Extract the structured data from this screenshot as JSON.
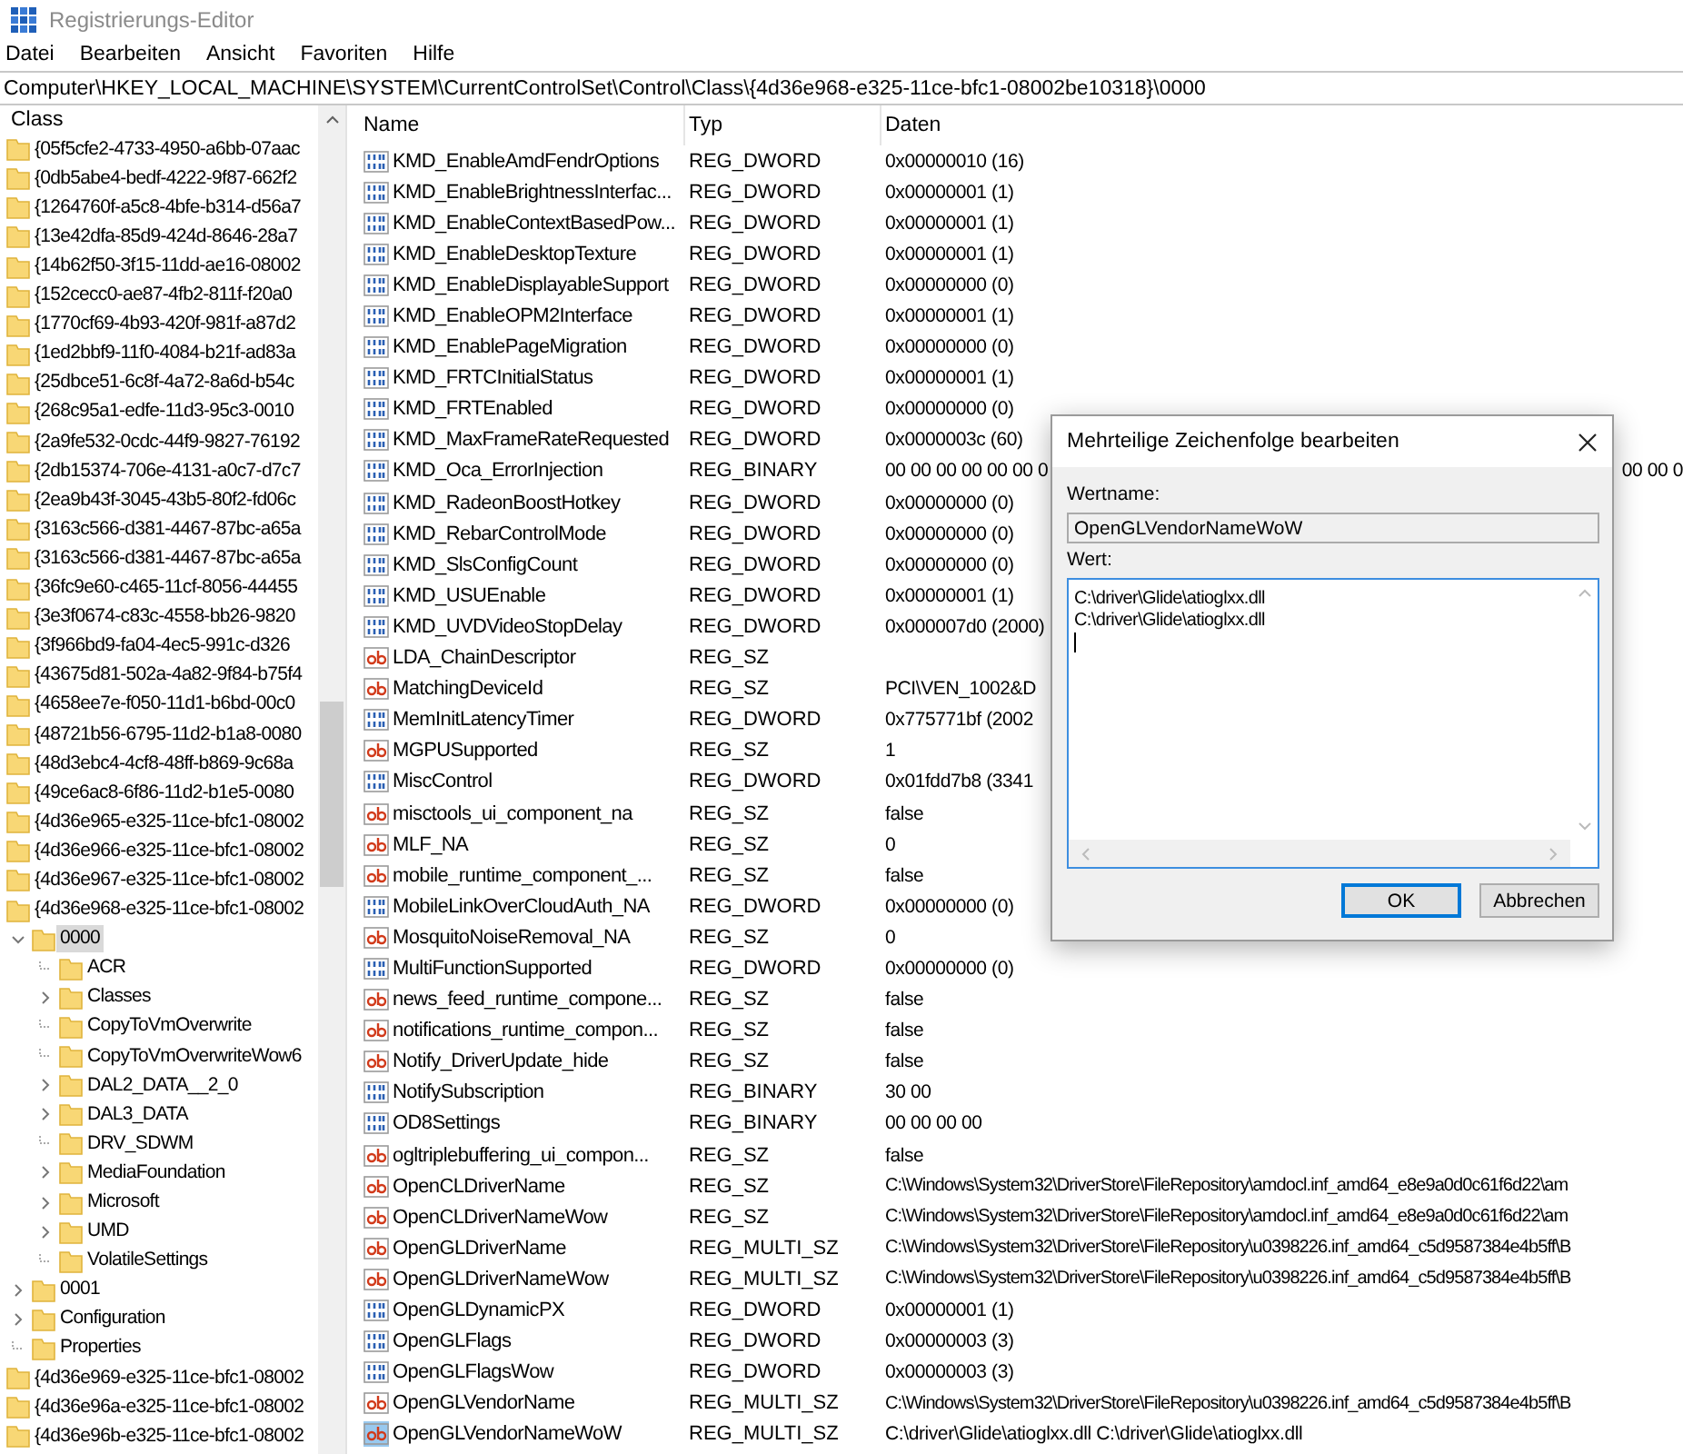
{
  "window": {
    "title": "Registrierungs-Editor"
  },
  "menu": [
    "Datei",
    "Bearbeiten",
    "Ansicht",
    "Favoriten",
    "Hilfe"
  ],
  "address": "Computer\\HKEY_LOCAL_MACHINE\\SYSTEM\\CurrentControlSet\\Control\\Class\\{4d36e968-e325-11ce-bfc1-08002be10318}\\0000",
  "tree": {
    "parent_label": "Class",
    "items": [
      {
        "label": "{05f5cfe2-4733-4950-a6bb-07aac",
        "selected": false
      },
      {
        "label": "{0db5abe4-bedf-4222-9f87-662f2",
        "selected": false
      },
      {
        "label": "{1264760f-a5c8-4bfe-b314-d56a7",
        "selected": false
      },
      {
        "label": "{13e42dfa-85d9-424d-8646-28a7",
        "selected": false
      },
      {
        "label": "{14b62f50-3f15-11dd-ae16-08002",
        "selected": false
      },
      {
        "label": "{152cecc0-ae87-4fb2-811f-f20a0",
        "selected": false
      },
      {
        "label": "{1770cf69-4b93-420f-981f-a87d2",
        "selected": false
      },
      {
        "label": "{1ed2bbf9-11f0-4084-b21f-ad83a",
        "selected": false
      },
      {
        "label": "{25dbce51-6c8f-4a72-8a6d-b54c",
        "selected": false
      },
      {
        "label": "{268c95a1-edfe-11d3-95c3-0010",
        "selected": false
      },
      {
        "label": "{2a9fe532-0cdc-44f9-9827-76192",
        "selected": false
      },
      {
        "label": "{2db15374-706e-4131-a0c7-d7c7",
        "selected": false
      },
      {
        "label": "{2ea9b43f-3045-43b5-80f2-fd06c",
        "selected": false
      },
      {
        "label": "{3163c566-d381-4467-87bc-a65a",
        "selected": false
      },
      {
        "label": "{3163c566-d381-4467-87bc-a65a",
        "selected": false
      },
      {
        "label": "{36fc9e60-c465-11cf-8056-44455",
        "selected": false
      },
      {
        "label": "{3e3f0674-c83c-4558-bb26-9820",
        "selected": false
      },
      {
        "label": "{3f966bd9-fa04-4ec5-991c-d326",
        "selected": false
      },
      {
        "label": "{43675d81-502a-4a82-9f84-b75f4",
        "selected": false
      },
      {
        "label": "{4658ee7e-f050-11d1-b6bd-00c0",
        "selected": false
      },
      {
        "label": "{48721b56-6795-11d2-b1a8-0080",
        "selected": false
      },
      {
        "label": "{48d3ebc4-4cf8-48ff-b869-9c68a",
        "selected": false
      },
      {
        "label": "{49ce6ac8-6f86-11d2-b1e5-0080",
        "selected": false
      },
      {
        "label": "{4d36e965-e325-11ce-bfc1-08002",
        "selected": false
      },
      {
        "label": "{4d36e966-e325-11ce-bfc1-08002",
        "selected": false
      },
      {
        "label": "{4d36e967-e325-11ce-bfc1-08002",
        "selected": false
      },
      {
        "label": "{4d36e968-e325-11ce-bfc1-08002",
        "selected": false,
        "children": [
          {
            "label": "0000",
            "selected": true,
            "expandable": true,
            "expanded": true,
            "children": [
              {
                "label": "ACR",
                "selected": false,
                "expandable": false
              },
              {
                "label": "Classes",
                "selected": false,
                "expandable": true,
                "expanded": false
              },
              {
                "label": "CopyToVmOverwrite",
                "selected": false,
                "expandable": false
              },
              {
                "label": "CopyToVmOverwriteWow6",
                "selected": false,
                "expandable": false
              },
              {
                "label": "DAL2_DATA__2_0",
                "selected": false,
                "expandable": true,
                "expanded": false
              },
              {
                "label": "DAL3_DATA",
                "selected": false,
                "expandable": true,
                "expanded": false
              },
              {
                "label": "DRV_SDWM",
                "selected": false,
                "expandable": false
              },
              {
                "label": "MediaFoundation",
                "selected": false,
                "expandable": true,
                "expanded": false
              },
              {
                "label": "Microsoft",
                "selected": false,
                "expandable": true,
                "expanded": false
              },
              {
                "label": "UMD",
                "selected": false,
                "expandable": true,
                "expanded": false
              },
              {
                "label": "VolatileSettings",
                "selected": false,
                "expandable": false
              }
            ]
          },
          {
            "label": "0001",
            "selected": false,
            "expandable": true,
            "expanded": false
          },
          {
            "label": "Configuration",
            "selected": false,
            "expandable": true,
            "expanded": false
          },
          {
            "label": "Properties",
            "selected": false,
            "expandable": false
          }
        ]
      },
      {
        "label": "{4d36e969-e325-11ce-bfc1-08002",
        "selected": false
      },
      {
        "label": "{4d36e96a-e325-11ce-bfc1-08002",
        "selected": false
      },
      {
        "label": "{4d36e96b-e325-11ce-bfc1-08002",
        "selected": false
      }
    ]
  },
  "table": {
    "columns": [
      "Name",
      "Typ",
      "Daten"
    ],
    "rows": [
      {
        "kind": "binary",
        "name": "KMD_EnableAmdFendrOptions",
        "type": "REG_DWORD",
        "data": "0x00000010 (16)",
        "selected": false
      },
      {
        "kind": "binary",
        "name": "KMD_EnableBrightnessInterfac...",
        "type": "REG_DWORD",
        "data": "0x00000001 (1)",
        "selected": false
      },
      {
        "kind": "binary",
        "name": "KMD_EnableContextBasedPow...",
        "type": "REG_DWORD",
        "data": "0x00000001 (1)",
        "selected": false
      },
      {
        "kind": "binary",
        "name": "KMD_EnableDesktopTexture",
        "type": "REG_DWORD",
        "data": "0x00000001 (1)",
        "selected": false
      },
      {
        "kind": "binary",
        "name": "KMD_EnableDisplayableSupport",
        "type": "REG_DWORD",
        "data": "0x00000000 (0)",
        "selected": false
      },
      {
        "kind": "binary",
        "name": "KMD_EnableOPM2Interface",
        "type": "REG_DWORD",
        "data": "0x00000001 (1)",
        "selected": false
      },
      {
        "kind": "binary",
        "name": "KMD_EnablePageMigration",
        "type": "REG_DWORD",
        "data": "0x00000000 (0)",
        "selected": false
      },
      {
        "kind": "binary",
        "name": "KMD_FRTCInitialStatus",
        "type": "REG_DWORD",
        "data": "0x00000001 (1)",
        "selected": false
      },
      {
        "kind": "binary",
        "name": "KMD_FRTEnabled",
        "type": "REG_DWORD",
        "data": "0x00000000 (0)",
        "selected": false
      },
      {
        "kind": "binary",
        "name": "KMD_MaxFrameRateRequested",
        "type": "REG_DWORD",
        "data": "0x0000003c (60)",
        "selected": false
      },
      {
        "kind": "binary",
        "name": "KMD_Oca_ErrorInjection",
        "type": "REG_BINARY",
        "data": "00 00 00 00 00 00 0",
        "data_tail": "00 00 0",
        "selected": false
      },
      {
        "kind": "binary",
        "name": "KMD_RadeonBoostHotkey",
        "type": "REG_DWORD",
        "data": "0x00000000 (0)",
        "selected": false
      },
      {
        "kind": "binary",
        "name": "KMD_RebarControlMode",
        "type": "REG_DWORD",
        "data": "0x00000000 (0)",
        "selected": false
      },
      {
        "kind": "binary",
        "name": "KMD_SlsConfigCount",
        "type": "REG_DWORD",
        "data": "0x00000000 (0)",
        "selected": false
      },
      {
        "kind": "binary",
        "name": "KMD_USUEnable",
        "type": "REG_DWORD",
        "data": "0x00000001 (1)",
        "selected": false
      },
      {
        "kind": "binary",
        "name": "KMD_UVDVideoStopDelay",
        "type": "REG_DWORD",
        "data": "0x000007d0 (2000)",
        "selected": false
      },
      {
        "kind": "string",
        "name": "LDA_ChainDescriptor",
        "type": "REG_SZ",
        "selected": false
      },
      {
        "kind": "string",
        "name": "MatchingDeviceId",
        "type": "REG_SZ",
        "data": "PCI\\VEN_1002&D",
        "selected": false
      },
      {
        "kind": "binary",
        "name": "MemInitLatencyTimer",
        "type": "REG_DWORD",
        "data": "0x775771bf (2002",
        "selected": false
      },
      {
        "kind": "string",
        "name": "MGPUSupported",
        "type": "REG_SZ",
        "data": "1",
        "selected": false
      },
      {
        "kind": "binary",
        "name": "MiscControl",
        "type": "REG_DWORD",
        "data": "0x01fdd7b8 (3341",
        "selected": false
      },
      {
        "kind": "string",
        "name": "misctools_ui_component_na",
        "type": "REG_SZ",
        "data": "false",
        "selected": false
      },
      {
        "kind": "string",
        "name": "MLF_NA",
        "type": "REG_SZ",
        "data": "0",
        "selected": false
      },
      {
        "kind": "string",
        "name": "mobile_runtime_component_...",
        "type": "REG_SZ",
        "data": "false",
        "selected": false
      },
      {
        "kind": "binary",
        "name": "MobileLinkOverCloudAuth_NA",
        "type": "REG_DWORD",
        "data": "0x00000000 (0)",
        "selected": false
      },
      {
        "kind": "string",
        "name": "MosquitoNoiseRemoval_NA",
        "type": "REG_SZ",
        "data": "0",
        "selected": false
      },
      {
        "kind": "binary",
        "name": "MultiFunctionSupported",
        "type": "REG_DWORD",
        "data": "0x00000000 (0)",
        "selected": false
      },
      {
        "kind": "string",
        "name": "news_feed_runtime_compone...",
        "type": "REG_SZ",
        "data": "false",
        "selected": false
      },
      {
        "kind": "string",
        "name": "notifications_runtime_compon...",
        "type": "REG_SZ",
        "data": "false",
        "selected": false
      },
      {
        "kind": "string",
        "name": "Notify_DriverUpdate_hide",
        "type": "REG_SZ",
        "data": "false",
        "selected": false
      },
      {
        "kind": "binary",
        "name": "NotifySubscription",
        "type": "REG_BINARY",
        "data": "30 00",
        "selected": false
      },
      {
        "kind": "binary",
        "name": "OD8Settings",
        "type": "REG_BINARY",
        "data": "00 00 00 00",
        "selected": false
      },
      {
        "kind": "string",
        "name": "ogltriplebuffering_ui_compon...",
        "type": "REG_SZ",
        "data": "false",
        "selected": false
      },
      {
        "kind": "string",
        "name": "OpenCLDriverName",
        "type": "REG_SZ",
        "data": "C:\\Windows\\System32\\DriverStore\\FileRepository\\amdocl.inf_amd64_e8e9a0d0c61f6d22\\am",
        "selected": false
      },
      {
        "kind": "string",
        "name": "OpenCLDriverNameWow",
        "type": "REG_SZ",
        "data": "C:\\Windows\\System32\\DriverStore\\FileRepository\\amdocl.inf_amd64_e8e9a0d0c61f6d22\\am",
        "selected": false
      },
      {
        "kind": "string",
        "name": "OpenGLDriverName",
        "type": "REG_MULTI_SZ",
        "data": "C:\\Windows\\System32\\DriverStore\\FileRepository\\u0398226.inf_amd64_c5d9587384e4b5ff\\B",
        "selected": false
      },
      {
        "kind": "string",
        "name": "OpenGLDriverNameWow",
        "type": "REG_MULTI_SZ",
        "data": "C:\\Windows\\System32\\DriverStore\\FileRepository\\u0398226.inf_amd64_c5d9587384e4b5ff\\B",
        "selected": false
      },
      {
        "kind": "binary",
        "name": "OpenGLDynamicPX",
        "type": "REG_DWORD",
        "data": "0x00000001 (1)",
        "selected": false
      },
      {
        "kind": "binary",
        "name": "OpenGLFlags",
        "type": "REG_DWORD",
        "data": "0x00000003 (3)",
        "selected": false
      },
      {
        "kind": "binary",
        "name": "OpenGLFlagsWow",
        "type": "REG_DWORD",
        "data": "0x00000003 (3)",
        "selected": false
      },
      {
        "kind": "string",
        "name": "OpenGLVendorName",
        "type": "REG_MULTI_SZ",
        "data": "C:\\Windows\\System32\\DriverStore\\FileRepository\\u0398226.inf_amd64_c5d9587384e4b5ff\\B",
        "selected": false
      },
      {
        "kind": "string",
        "name": "OpenGLVendorNameWoW",
        "type": "REG_MULTI_SZ",
        "data": "C:\\driver\\Glide\\atioglxx.dll C:\\driver\\Glide\\atioglxx.dll",
        "selected": true
      }
    ]
  },
  "dialog": {
    "title": "Mehrteilige Zeichenfolge bearbeiten",
    "name_label": "Wertname:",
    "name_value": "OpenGLVendorNameWoW",
    "value_label": "Wert:",
    "value_lines": [
      "C:\\driver\\Glide\\atioglxx.dll",
      "C:\\driver\\Glide\\atioglxx.dll"
    ],
    "buttons": [
      {
        "label": "OK",
        "default": true
      },
      {
        "label": "Abbrechen",
        "default": false
      }
    ]
  }
}
